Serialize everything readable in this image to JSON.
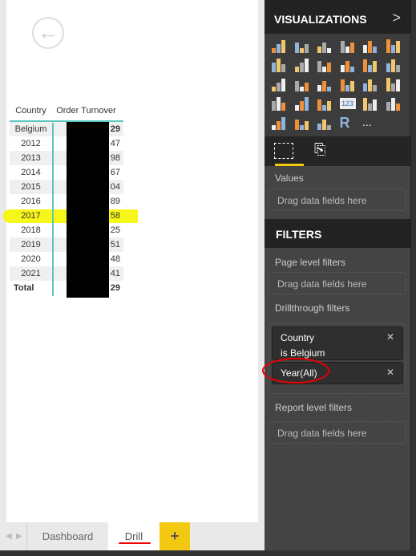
{
  "canvas": {
    "back_icon": "back-arrow-circle-icon",
    "table": {
      "headers": [
        "Country",
        "Order Turnover"
      ],
      "rows": [
        {
          "label": "Belgium",
          "value": "29",
          "bold": true
        },
        {
          "label": "2012",
          "value": "47"
        },
        {
          "label": "2013",
          "value": "98"
        },
        {
          "label": "2014",
          "value": "67"
        },
        {
          "label": "2015",
          "value": "04"
        },
        {
          "label": "2016",
          "value": "89"
        },
        {
          "label": "2017",
          "value": "58"
        },
        {
          "label": "2018",
          "value": "25"
        },
        {
          "label": "2019",
          "value": "51"
        },
        {
          "label": "2020",
          "value": "48"
        },
        {
          "label": "2021",
          "value": "41"
        }
      ],
      "total": {
        "label": "Total",
        "value": "29"
      },
      "highlight_row": "2017",
      "highlight_color": "#f5f500",
      "accent": "#5cc7bd"
    }
  },
  "visualizations": {
    "title": "VISUALIZATIONS",
    "collapse": ">",
    "more": "...",
    "r_label": "R",
    "card_label": "123",
    "values_label": "Values",
    "values_placeholder": "Drag data fields here"
  },
  "filters": {
    "title": "FILTERS",
    "page_label": "Page level filters",
    "page_placeholder": "Drag data fields here",
    "drill_label": "Drillthrough filters",
    "cards": [
      {
        "title": "Country",
        "sub": "is Belgium"
      },
      {
        "title": "Year(All)"
      }
    ],
    "report_label": "Report level filters",
    "report_placeholder": "Drag data fields here"
  },
  "pages": {
    "tabs": [
      "Dashboard",
      "Drill"
    ],
    "active": "Drill",
    "add": "+",
    "accent": "#f2c811"
  }
}
